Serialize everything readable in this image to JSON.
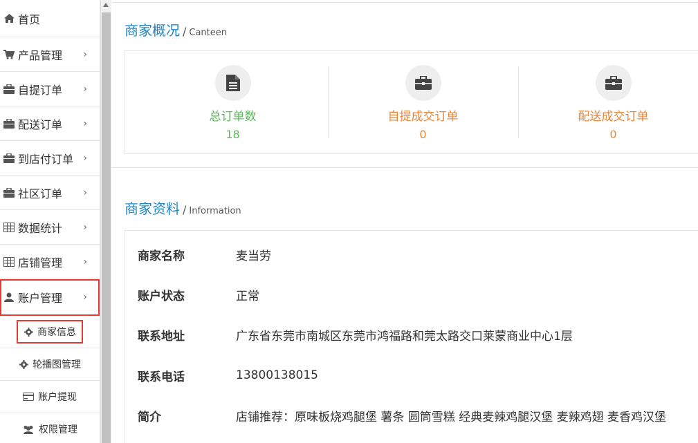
{
  "sidebar": {
    "items": [
      {
        "label": "首页",
        "icon": "home-icon",
        "has_arrow": false
      },
      {
        "label": "产品管理",
        "icon": "cart-icon",
        "has_arrow": true
      },
      {
        "label": "自提订单",
        "icon": "briefcase-icon",
        "has_arrow": true
      },
      {
        "label": "配送订单",
        "icon": "briefcase-icon",
        "has_arrow": true
      },
      {
        "label": "到店付订单",
        "icon": "briefcase-icon",
        "has_arrow": true
      },
      {
        "label": "社区订单",
        "icon": "briefcase-icon",
        "has_arrow": true
      },
      {
        "label": "数据统计",
        "icon": "table-icon",
        "has_arrow": true
      },
      {
        "label": "店铺管理",
        "icon": "table-icon",
        "has_arrow": true
      },
      {
        "label": "账户管理",
        "icon": "user-icon",
        "has_arrow": true
      }
    ],
    "chevron": "›",
    "sub_items": [
      {
        "label": "商家信息",
        "icon": "gear-icon"
      },
      {
        "label": "轮播图管理",
        "icon": "gear-icon"
      },
      {
        "label": "账户提现",
        "icon": "credit-card-icon"
      },
      {
        "label": "权限管理",
        "icon": "users-icon"
      }
    ]
  },
  "overview": {
    "title": "商家概况",
    "subtitle": "Canteen",
    "stats": [
      {
        "label": "总订单数",
        "value": "18",
        "icon": "document-icon",
        "color": "#5cb85c"
      },
      {
        "label": "自提成交订单",
        "value": "0",
        "icon": "briefcase-icon",
        "color": "#e8863a"
      },
      {
        "label": "配送成交订单",
        "value": "0",
        "icon": "briefcase-icon",
        "color": "#e8863a"
      }
    ]
  },
  "info": {
    "title": "商家资料",
    "subtitle": "Information",
    "rows": [
      {
        "key": "商家名称",
        "value": "麦当劳"
      },
      {
        "key": "账户状态",
        "value": "正常"
      },
      {
        "key": "联系地址",
        "value": "广东省东莞市南城区东莞市鸿福路和莞太路交口莱蒙商业中心1层"
      },
      {
        "key": "联系电话",
        "value": "13800138015"
      },
      {
        "key": "简介",
        "value": "店铺推荐：原味板烧鸡腿堡 薯条 圆筒雪糕 经典麦辣鸡腿汉堡 麦辣鸡翅 麦香鸡汉堡"
      }
    ]
  },
  "colors": {
    "accent": "#1e88c7",
    "highlight": "#e53935",
    "green": "#5cb85c",
    "orange": "#e8863a"
  }
}
